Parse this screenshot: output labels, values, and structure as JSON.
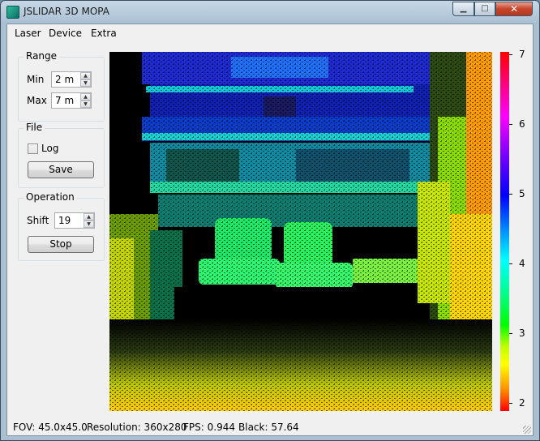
{
  "window": {
    "title": "JSLIDAR 3D MOPA",
    "minimize_glyph": "▁",
    "maximize_glyph": "□",
    "close_glyph": "✕"
  },
  "menu": {
    "items": [
      "Laser",
      "Device",
      "Extra"
    ]
  },
  "range": {
    "title": "Range",
    "min_label": "Min",
    "min_value": "2 m",
    "max_label": "Max",
    "max_value": "7 m"
  },
  "file": {
    "title": "File",
    "log_label": "Log",
    "log_checked": false,
    "save_label": "Save"
  },
  "operation": {
    "title": "Operation",
    "shift_label": "Shift",
    "shift_value": "19",
    "stop_label": "Stop"
  },
  "colorbar": {
    "ticks": [
      "7",
      "6",
      "5",
      "4",
      "3",
      "2"
    ]
  },
  "status": {
    "fov": "FOV: 45.0x45.0",
    "resolution": "Resolution: 360x280",
    "fps": "FPS: 0.944",
    "black": "Black: 57.64"
  },
  "icons": {
    "app": "lidar-app-icon",
    "spin_up": "▲",
    "spin_down": "▼"
  }
}
